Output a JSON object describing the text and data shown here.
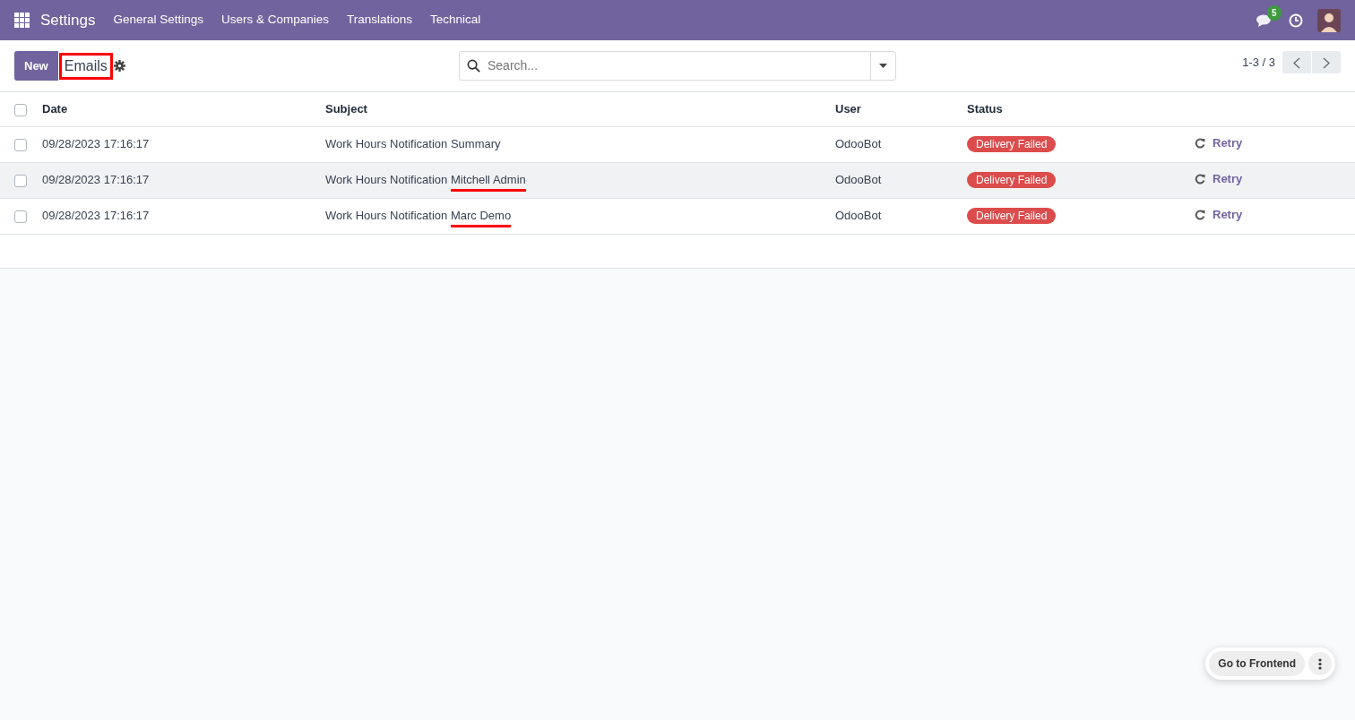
{
  "navbar": {
    "app": "Settings",
    "menu": [
      "General Settings",
      "Users & Companies",
      "Translations",
      "Technical"
    ],
    "messages_badge": "5"
  },
  "control_panel": {
    "new_button": "New",
    "title": "Emails",
    "title_highlighted": true,
    "search": {
      "placeholder": "Search..."
    },
    "pager": "1-3 / 3"
  },
  "table": {
    "columns": [
      "Date",
      "Subject",
      "User",
      "Status"
    ],
    "header_checked": false,
    "rows": [
      {
        "checked": false,
        "date": "09/28/2023 17:16:17",
        "subject": "Work Hours Notification",
        "subject_end": "Summary",
        "underlined": false,
        "user": "OdooBot",
        "status": "Delivery Failed",
        "action": "Retry",
        "hovered": false
      },
      {
        "checked": false,
        "date": "09/28/2023 17:16:17",
        "subject": "Work Hours Notification",
        "subject_end": "Mitchell Admin",
        "underlined": true,
        "user": "OdooBot",
        "status": "Delivery Failed",
        "action": "Retry",
        "hovered": true
      },
      {
        "checked": false,
        "date": "09/28/2023 17:16:17",
        "subject": "Work Hours Notification",
        "subject_end": "Marc Demo",
        "underlined": true,
        "user": "OdooBot",
        "status": "Delivery Failed",
        "action": "Retry",
        "hovered": false
      }
    ]
  },
  "floating": {
    "button": "Go to Frontend"
  }
}
